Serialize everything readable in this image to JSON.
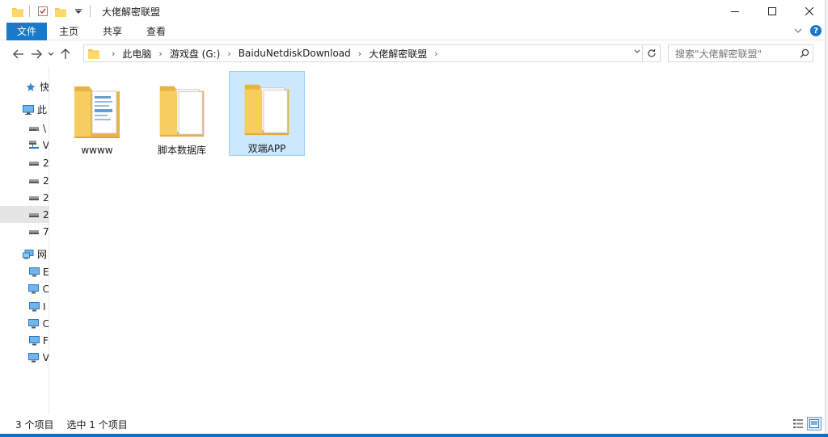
{
  "window": {
    "title": "大佬解密联盟",
    "controls": {
      "minimize": "—",
      "maximize": "☐",
      "close": "✕"
    }
  },
  "ribbon": {
    "tabs": [
      "文件",
      "主页",
      "共享",
      "查看"
    ],
    "expand_icon": "chevron-down-icon",
    "help": "?"
  },
  "nav": {
    "back": "←",
    "forward": "→",
    "recent": "⌄",
    "up": "↑",
    "breadcrumb": [
      "此电脑",
      "游戏盘 (G:)",
      "BaiduNetdiskDownload",
      "大佬解密联盟"
    ],
    "separator": "›",
    "refresh": "↻"
  },
  "search": {
    "placeholder": "搜索\"大佬解密联盟\""
  },
  "navpane": {
    "items": [
      {
        "label": "快",
        "icon": "star-icon",
        "kind": "quick"
      },
      {
        "label": "此",
        "icon": "computer-icon",
        "kind": "pc"
      },
      {
        "label": "\\",
        "icon": "drive-icon",
        "kind": "drive"
      },
      {
        "label": "V",
        "icon": "network-drive-icon",
        "kind": "netdrive"
      },
      {
        "label": "2",
        "icon": "drive-icon",
        "kind": "drive"
      },
      {
        "label": "2",
        "icon": "drive-icon",
        "kind": "drive"
      },
      {
        "label": "2",
        "icon": "drive-icon",
        "kind": "drive"
      },
      {
        "label": "2",
        "icon": "drive-icon",
        "kind": "drive",
        "selected": true
      },
      {
        "label": "7",
        "icon": "drive-icon",
        "kind": "drive"
      },
      {
        "label": "网",
        "icon": "network-icon",
        "kind": "network"
      },
      {
        "label": "E",
        "icon": "monitor-icon",
        "kind": "pcnet"
      },
      {
        "label": "C",
        "icon": "monitor-icon",
        "kind": "pcnet"
      },
      {
        "label": "I",
        "icon": "monitor-icon",
        "kind": "pcnet"
      },
      {
        "label": "C",
        "icon": "monitor-icon",
        "kind": "pcnet"
      },
      {
        "label": "F",
        "icon": "monitor-icon",
        "kind": "pcnet"
      },
      {
        "label": "V",
        "icon": "monitor-icon",
        "kind": "pcnet"
      }
    ]
  },
  "content": {
    "folders": [
      {
        "name": "wwww",
        "selected": false
      },
      {
        "name": "脚本数据库",
        "selected": false
      },
      {
        "name": "双端APP",
        "selected": true
      }
    ]
  },
  "status": {
    "count": "3 个项目",
    "selection": "选中 1 个项目"
  },
  "colors": {
    "accent": "#1979ca",
    "selection_bg": "#cce8ff",
    "selection_border": "#99d1ff",
    "folder": "#f4c75a"
  }
}
